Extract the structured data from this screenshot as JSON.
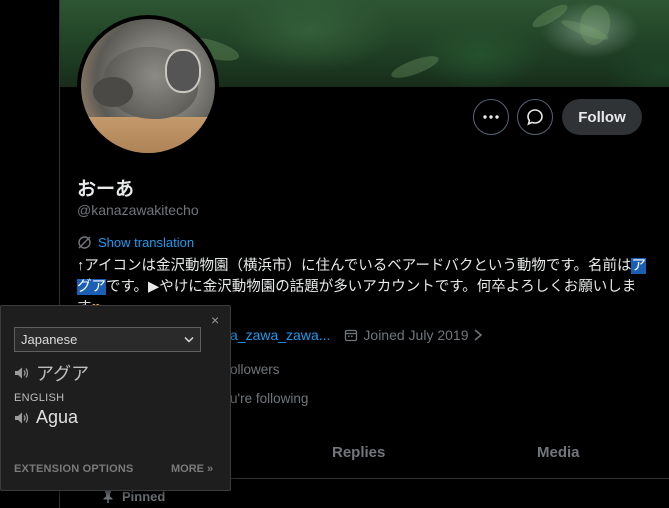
{
  "profile": {
    "display_name": "おーあ",
    "handle": "@kanazawakitecho",
    "follow_label": "Follow",
    "show_translation": "Show translation",
    "bio_before": "↑アイコンは金沢動物園（横浜市）に住んでいるベアードバクという動物です。名前は",
    "bio_highlight": "アグア",
    "bio_after": "です。▶やけに金沢動物園の話題が多いアカウントです。何卒よろしくお願いします",
    "link_text": "a_zawa_zawa...",
    "joined": "Joined July 2019",
    "followers_text": "ollowers",
    "following_text": "u're following"
  },
  "tabs": {
    "replies": "Replies",
    "media": "Media"
  },
  "pinned_label": "Pinned",
  "popup": {
    "close": "×",
    "source_language": "Japanese",
    "source_text": "アグア",
    "target_language_label": "ENGLISH",
    "target_text": "Agua",
    "extension_options": "EXTENSION OPTIONS",
    "more": "MORE »"
  }
}
